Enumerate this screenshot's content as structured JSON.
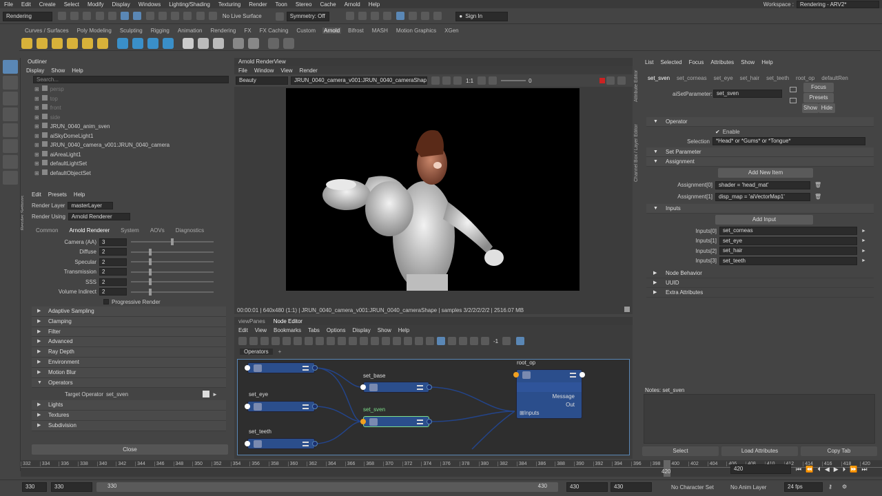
{
  "menubar": {
    "items": [
      "File",
      "Edit",
      "Create",
      "Select",
      "Modify",
      "Display",
      "Windows",
      "Lighting/Shading",
      "Texturing",
      "Render",
      "Toon",
      "Stereo",
      "Cache",
      "Arnold",
      "Help"
    ],
    "workspace_label": "Workspace :",
    "workspace_value": "Rendering - ARV2*"
  },
  "status": {
    "mode": "Rendering",
    "live_surface": "No Live Surface",
    "symmetry": "Symmetry: Off",
    "signin": "Sign In"
  },
  "shelf": {
    "tabs": [
      "Curves / Surfaces",
      "Poly Modeling",
      "Sculpting",
      "Rigging",
      "Animation",
      "Rendering",
      "FX",
      "FX Caching",
      "Custom",
      "Arnold",
      "Bifrost",
      "MASH",
      "Motion Graphics",
      "XGen"
    ],
    "active": "Arnold"
  },
  "outliner": {
    "title": "Outliner",
    "menu": [
      "Display",
      "Show",
      "Help"
    ],
    "search_placeholder": "Search...",
    "items": [
      {
        "label": "persp",
        "dim": true
      },
      {
        "label": "top",
        "dim": true
      },
      {
        "label": "front",
        "dim": true
      },
      {
        "label": "side",
        "dim": true
      },
      {
        "label": "JRUN_0040_anim_sven",
        "dim": false
      },
      {
        "label": "aiSkyDomeLight1",
        "dim": false
      },
      {
        "label": "JRUN_0040_camera_v001:JRUN_0040_camera",
        "dim": false
      },
      {
        "label": "aiAreaLight1",
        "dim": false
      },
      {
        "label": "defaultLightSet",
        "dim": false
      },
      {
        "label": "defaultObjectSet",
        "dim": false
      }
    ]
  },
  "render_settings": {
    "side_label": "Render Settings",
    "menu": [
      "Edit",
      "Presets",
      "Help"
    ],
    "render_layer_label": "Render Layer",
    "render_layer_value": "masterLayer",
    "render_using_label": "Render Using",
    "render_using_value": "Arnold Renderer",
    "tabs": [
      "Common",
      "Arnold Renderer",
      "System",
      "AOVs",
      "Diagnostics"
    ],
    "active_tab": "Arnold Renderer",
    "params": [
      {
        "label": "Camera (AA)",
        "value": "3",
        "level": 0.5
      },
      {
        "label": "Diffuse",
        "value": "2",
        "level": 0.22
      },
      {
        "label": "Specular",
        "value": "2",
        "level": 0.22
      },
      {
        "label": "Transmission",
        "value": "2",
        "level": 0.22
      },
      {
        "label": "SSS",
        "value": "2",
        "level": 0.22
      },
      {
        "label": "Volume Indirect",
        "value": "2",
        "level": 0.22
      }
    ],
    "progressive": "Progressive Render",
    "sections_a": [
      "Adaptive Sampling",
      "Clamping",
      "Filter",
      "Advanced"
    ],
    "sections_b": [
      "Ray Depth",
      "Environment",
      "Motion Blur"
    ],
    "operators_section": "Operators",
    "target_operator_label": "Target Operator",
    "target_operator_value": "set_sven",
    "sections_c": [
      "Lights",
      "Textures",
      "Subdivision"
    ],
    "close": "Close"
  },
  "renderview": {
    "title": "Arnold RenderView",
    "menu": [
      "File",
      "Window",
      "View",
      "Render"
    ],
    "aov": "Beauty",
    "camera": "JRUN_0040_camera_v001:JRUN_0040_cameraShape",
    "ratio": "1:1",
    "exposure": "0",
    "status": "00:00:01 | 640x480 (1:1) | JRUN_0040_camera_v001:JRUN_0040_cameraShape | samples 3/2/2/2/2/2 | 2516.07 MB"
  },
  "node_editor": {
    "tabs": [
      "viewPanes",
      "Node Editor"
    ],
    "active_tab": "Node Editor",
    "menu": [
      "Edit",
      "View",
      "Bookmarks",
      "Tabs",
      "Options",
      "Display",
      "Show",
      "Help"
    ],
    "graph_tab": "Operators",
    "add_tab": "+",
    "zoom_value": "-1",
    "nodes": {
      "set_base": "set_base",
      "set_eye": "set_eye",
      "set_sven": "set_sven",
      "set_teeth": "set_teeth",
      "root_op": "root_op",
      "message": "Message",
      "out": "Out",
      "inputs": "Inputs"
    }
  },
  "attribute_editor": {
    "side_labels": [
      "Attribute Editor",
      "Channel Box / Layer Editor"
    ],
    "menu": [
      "List",
      "Selected",
      "Focus",
      "Attributes",
      "Show",
      "Help"
    ],
    "tabs": [
      "set_sven",
      "set_corneas",
      "set_eye",
      "set_hair",
      "set_teeth",
      "root_op",
      "defaultRen"
    ],
    "active_tab": "set_sven",
    "type_label": "aiSetParameter:",
    "type_value": "set_sven",
    "focus": "Focus",
    "presets": "Presets",
    "show": "Show",
    "hide": "Hide",
    "operator_section": "Operator",
    "enable": "Enable",
    "selection_label": "Selection",
    "selection_value": "*Head* or *Gums* or *Tongue*",
    "set_parameter_section": "Set Parameter",
    "assignment_section": "Assignment",
    "add_new_item": "Add New Item",
    "assignments": [
      {
        "label": "Assignment[0]",
        "value": "shader = 'head_mat'"
      },
      {
        "label": "Assignment[1]",
        "value": "disp_map = 'aiVectorMap1'"
      }
    ],
    "inputs_section": "Inputs",
    "add_input": "Add Input",
    "inputs": [
      {
        "label": "Inputs[0]",
        "value": "set_corneas"
      },
      {
        "label": "Inputs[1]",
        "value": "set_eye"
      },
      {
        "label": "Inputs[2]",
        "value": "set_hair"
      },
      {
        "label": "Inputs[3]",
        "value": "set_teeth"
      }
    ],
    "closed_sections": [
      "Node Behavior",
      "UUID",
      "Extra Attributes"
    ],
    "notes": "Notes: set_sven",
    "bottom_buttons": [
      "Select",
      "Load Attributes",
      "Copy Tab"
    ]
  },
  "timeline": {
    "ticks": [
      "332",
      "334",
      "336",
      "338",
      "340",
      "342",
      "344",
      "346",
      "348",
      "350",
      "352",
      "354",
      "356",
      "358",
      "360",
      "362",
      "364",
      "366",
      "368",
      "370",
      "372",
      "374",
      "376",
      "378",
      "380",
      "382",
      "384",
      "386",
      "388",
      "390",
      "392",
      "394",
      "396",
      "398",
      "400",
      "402",
      "404",
      "406",
      "408",
      "410",
      "412",
      "414",
      "416",
      "418",
      "420"
    ],
    "current_frame": "420",
    "current_frame_field": "420"
  },
  "range": {
    "start": "330",
    "inner_start": "330",
    "inner_end": "430",
    "end": "430",
    "end2": "430",
    "char_set": "No Character Set",
    "anim_layer": "No Anim Layer",
    "fps": "24 fps"
  }
}
